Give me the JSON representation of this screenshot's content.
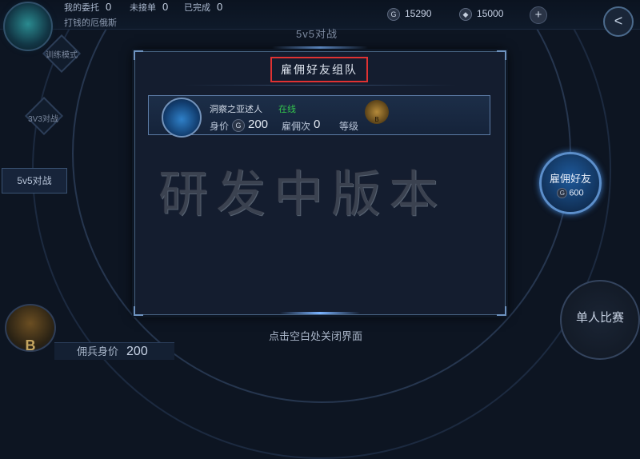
{
  "topbar": {
    "stats": [
      {
        "label": "我的委托",
        "value": "0"
      },
      {
        "label": "未接单",
        "value": "0"
      },
      {
        "label": "已完成",
        "value": "0"
      }
    ],
    "player_name": "打钱的厄俄斯",
    "currency_gold": {
      "icon": "G",
      "value": "15290"
    },
    "currency_gem": {
      "value": "15000"
    },
    "plus_label": "+",
    "back_label": "<"
  },
  "mode_title": "5v5对战",
  "sidebar": {
    "items": [
      {
        "label": "训练模式"
      },
      {
        "label": "3V3对战"
      },
      {
        "label": "5v5对战"
      }
    ]
  },
  "rank_badge_letter": "B",
  "mercenary": {
    "label": "佣兵身价",
    "value": "200"
  },
  "panel": {
    "title": "雇佣好友组队",
    "friend": {
      "name": "洞察之亚述人",
      "status": "在线",
      "price_label": "身价",
      "price_icon": "G",
      "price_value": "200",
      "hire_count_label": "雇佣次",
      "hire_count_value": "0",
      "rank_label": "等级",
      "rank_letter": "B"
    },
    "watermark": "研发中版本"
  },
  "hire_button": {
    "label": "雇佣好友",
    "cost_icon": "G",
    "cost": "600"
  },
  "single_match_label": "单人比赛",
  "close_hint": "点击空白处关闭界面",
  "colors": {
    "accent": "#5c8fcb",
    "highlight": "#e03232",
    "online": "#33c24d"
  }
}
